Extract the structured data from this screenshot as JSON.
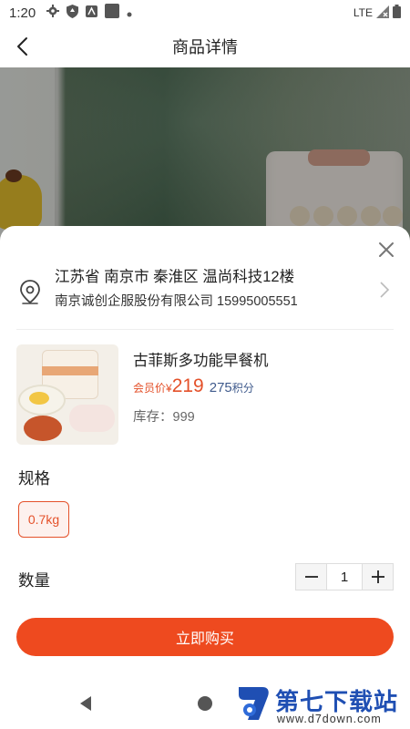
{
  "status_bar": {
    "time": "1:20",
    "network": "LTE"
  },
  "header": {
    "title": "商品详情"
  },
  "address": {
    "line1": "江苏省 南京市 秦淮区 温尚科技12楼",
    "line2": "南京诚创企服股份有限公司 15995005551"
  },
  "product": {
    "name": "古菲斯多功能早餐机",
    "price_label": "会员价",
    "currency": "¥",
    "price": "219",
    "points": "275",
    "points_label": "积分",
    "stock_label": "库存：",
    "stock": "999"
  },
  "spec": {
    "title": "规格",
    "options": [
      "0.7kg"
    ],
    "selected": "0.7kg"
  },
  "quantity": {
    "title": "数量",
    "value": "1"
  },
  "buy_button": {
    "label": "立即购买"
  },
  "watermark": {
    "title": "第七下载站",
    "url": "www.d7down.com"
  },
  "colors": {
    "accent": "#ee4a1f",
    "price": "#e4512a",
    "points": "#3f5a8c",
    "brand": "#1f4fb3"
  }
}
